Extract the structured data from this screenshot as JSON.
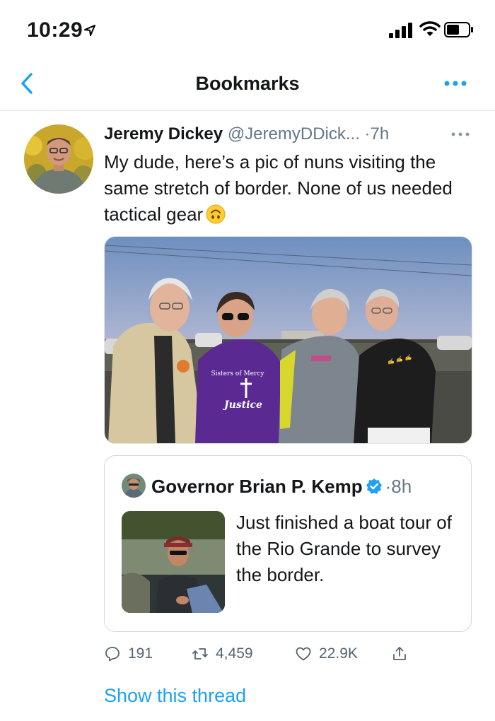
{
  "status_bar": {
    "time": "10:29",
    "icons": [
      "location-arrow-icon",
      "signal-bars-icon",
      "wifi-icon",
      "battery-icon"
    ]
  },
  "nav": {
    "title": "Bookmarks",
    "back_icon": "chevron-left-icon",
    "more_icon": "ellipsis-icon",
    "accent_color": "#1da1f2"
  },
  "tweet": {
    "author_name": "Jeremy Dickey",
    "author_handle": "@JeremyDDick...",
    "separator_time": "·7h",
    "text": "My dude, here’s a pic of nuns visiting the same stretch of border. None of us needed tactical gear",
    "emoji": "upside-down-face-emoji",
    "photo": {
      "shirt_text_line1": "Sisters of Mercy",
      "shirt_text_line2": "Justice"
    },
    "quote": {
      "author_name": "Governor Brian P. Kemp",
      "verified_icon": "verified-badge-icon",
      "time": "·8h",
      "text": "Just finished a boat tour of the Rio Grande to survey the border."
    },
    "actions": {
      "replies": "191",
      "retweets": "4,459",
      "likes": "22.9K",
      "reply_icon": "reply-bubble-icon",
      "retweet_icon": "retweet-icon",
      "like_icon": "heart-icon",
      "share_icon": "share-icon"
    },
    "show_thread": "Show this thread"
  },
  "colors": {
    "text_primary": "#14171a",
    "text_secondary": "#657786",
    "link": "#1da1f2",
    "border": "#e1e8ed"
  }
}
